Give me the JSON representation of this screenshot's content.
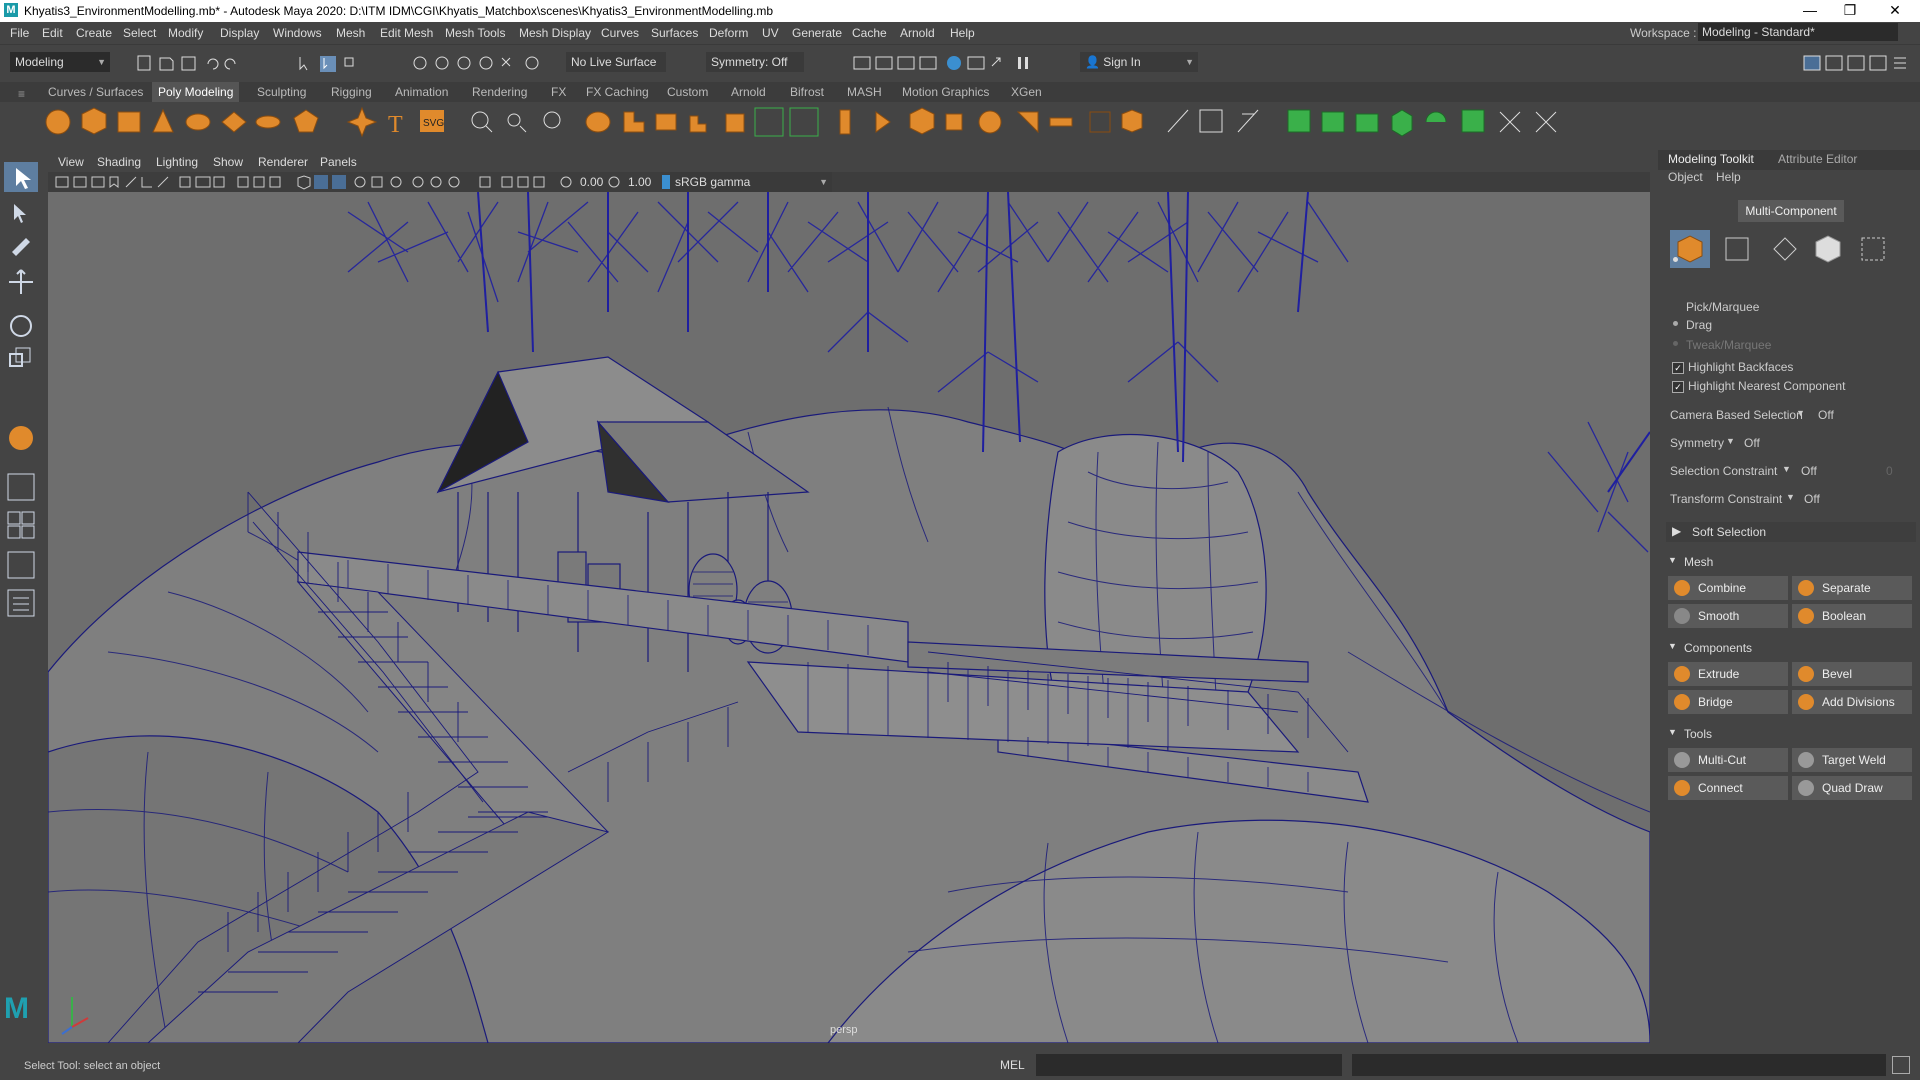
{
  "window": {
    "title": "Khyatis3_EnvironmentModelling.mb* - Autodesk Maya 2020: D:\\ITM IDM\\CGI\\Khyatis_Matchbox\\scenes\\Khyatis3_EnvironmentModelling.mb",
    "logo": "M",
    "controls": [
      "—",
      "❐",
      "✕"
    ]
  },
  "menubar": {
    "items": [
      "File",
      "Edit",
      "Create",
      "Select",
      "Modify",
      "Display",
      "Windows",
      "Mesh",
      "Edit Mesh",
      "Mesh Tools",
      "Mesh Display",
      "Curves",
      "Surfaces",
      "Deform",
      "UV",
      "Generate",
      "Cache",
      "Arnold",
      "Help"
    ],
    "workspace_label": "Workspace :",
    "workspace_value": "Modeling - Standard*"
  },
  "statusline": {
    "mode": "Modeling",
    "live_surface": "No Live Surface",
    "symmetry": "Symmetry: Off",
    "sign_in": "Sign In"
  },
  "shelf": {
    "tabs": [
      "Curves / Surfaces",
      "Poly Modeling",
      "Sculpting",
      "Rigging",
      "Animation",
      "Rendering",
      "FX",
      "FX Caching",
      "Custom",
      "Arnold",
      "Bifrost",
      "MASH",
      "Motion Graphics",
      "XGen"
    ],
    "active_tab": "Poly Modeling",
    "icon_names": [
      "sphere-icon",
      "cube-icon",
      "cylinder-icon",
      "cone-icon",
      "torus-icon",
      "plane-icon",
      "disc-icon",
      "platonic-icon",
      "superellipse-icon",
      "text-icon",
      "svg-icon"
    ],
    "svg_label": "SVG",
    "text_label": "T"
  },
  "viewport": {
    "menu": [
      "View",
      "Shading",
      "Lighting",
      "Show",
      "Renderer",
      "Panels"
    ],
    "exposure": "0.00",
    "gamma": "1.00",
    "color_space": "sRGB gamma",
    "camera_label": "persp",
    "colors": {
      "wire": "#1a1a7a",
      "surface": "#7f7f7f",
      "sky": "#6e6e6e"
    }
  },
  "modeling_toolkit": {
    "tabs": [
      "Modeling Toolkit",
      "Attribute Editor"
    ],
    "menu": [
      "Object",
      "Help"
    ],
    "multi_component": "Multi-Component",
    "selection_modes": [
      "Pick/Marquee",
      "Drag",
      "Tweak/Marquee"
    ],
    "checkboxes": [
      {
        "label": "Highlight Backfaces",
        "checked": true
      },
      {
        "label": "Highlight Nearest Component",
        "checked": true
      }
    ],
    "options": [
      {
        "label": "Camera Based Selection",
        "value": "Off"
      },
      {
        "label": "Symmetry",
        "value": "Off"
      },
      {
        "label": "Selection Constraint",
        "value": "Off",
        "extra": "0"
      },
      {
        "label": "Transform Constraint",
        "value": "Off"
      }
    ],
    "soft_selection": "Soft Selection",
    "sections": {
      "mesh": {
        "title": "Mesh",
        "buttons": [
          "Combine",
          "Separate",
          "Smooth",
          "Boolean"
        ]
      },
      "components": {
        "title": "Components",
        "buttons": [
          "Extrude",
          "Bevel",
          "Bridge",
          "Add Divisions"
        ]
      },
      "tools": {
        "title": "Tools",
        "buttons": [
          "Multi-Cut",
          "Target Weld",
          "Connect",
          "Quad Draw"
        ]
      }
    }
  },
  "helpline": {
    "text": "Select Tool: select an object",
    "mel_label": "MEL"
  }
}
